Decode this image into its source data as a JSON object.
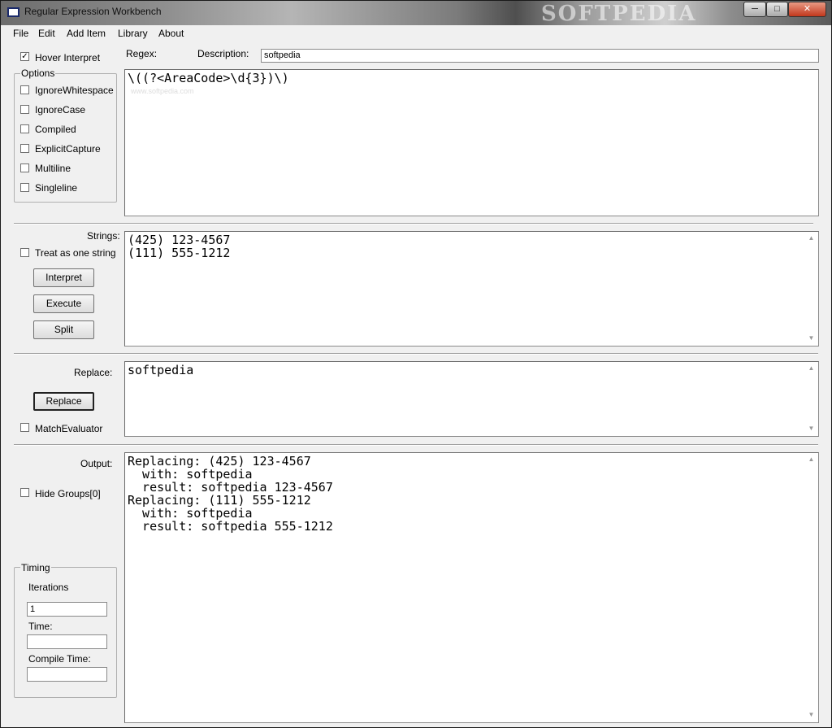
{
  "window": {
    "title": "Regular Expression Workbench",
    "watermark": "SOFTPEDIA",
    "minimize": "─",
    "maximize": "□",
    "close": "✕"
  },
  "menu": [
    "File",
    "Edit",
    "Add Item",
    "Library",
    "About"
  ],
  "regex_section": {
    "hover_interpret_label": "Hover Interpret",
    "hover_interpret_checked": true,
    "options_title": "Options",
    "options": [
      {
        "label": "IgnoreWhitespace",
        "checked": false
      },
      {
        "label": "IgnoreCase",
        "checked": false
      },
      {
        "label": "Compiled",
        "checked": false
      },
      {
        "label": "ExplicitCapture",
        "checked": false
      },
      {
        "label": "Multiline",
        "checked": false
      },
      {
        "label": "Singleline",
        "checked": false
      }
    ],
    "regex_label": "Regex:",
    "description_label": "Description:",
    "description_value": "softpedia",
    "regex_value": "\\((?<AreaCode>\\d{3})\\)",
    "editor_watermark": "www.softpedia.com"
  },
  "strings_section": {
    "label": "Strings:",
    "treat_as_one_label": "Treat as one string",
    "treat_as_one_checked": false,
    "interpret_button": "Interpret",
    "execute_button": "Execute",
    "split_button": "Split",
    "value": "(425) 123-4567\n(111) 555-1212"
  },
  "replace_section": {
    "label": "Replace:",
    "replace_button": "Replace",
    "match_evaluator_label": "MatchEvaluator",
    "match_evaluator_checked": false,
    "value": "softpedia"
  },
  "output_section": {
    "label": "Output:",
    "hide_groups_label": "Hide Groups[0]",
    "hide_groups_checked": false,
    "value": "Replacing: (425) 123-4567\n  with: softpedia\n  result: softpedia 123-4567\nReplacing: (111) 555-1212\n  with: softpedia\n  result: softpedia 555-1212",
    "timing": {
      "title": "Timing",
      "iterations_label": "Iterations",
      "iterations_value": "1",
      "time_label": "Time:",
      "time_value": "",
      "compile_time_label": "Compile Time:",
      "compile_time_value": ""
    }
  },
  "scroll": {
    "up": "▲",
    "down": "▼"
  }
}
